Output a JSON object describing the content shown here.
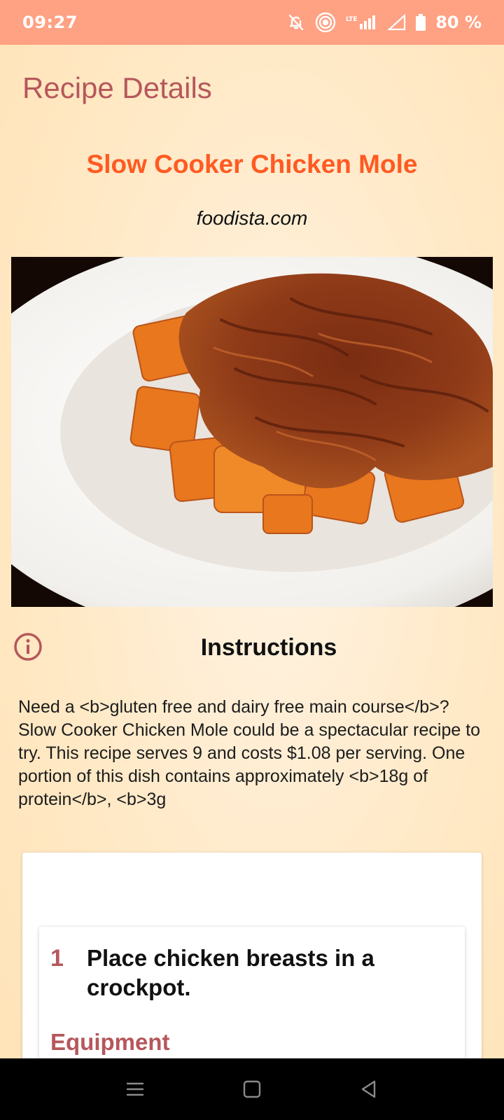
{
  "status_bar": {
    "time": "09:27",
    "battery_percent": "80 %",
    "network_label": "LTE",
    "icons": [
      "mute-icon",
      "hotspot-icon",
      "signal-icon",
      "signal-empty-icon",
      "battery-icon"
    ]
  },
  "header": {
    "title": "Recipe Details"
  },
  "recipe": {
    "title": "Slow Cooker Chicken Mole",
    "source": "foodista.com",
    "image_alt": "Slow Cooker Chicken Mole"
  },
  "instructions": {
    "heading": "Instructions",
    "summary": "Need a <b>gluten free and dairy free main course</b>? Slow Cooker Chicken Mole could be a spectacular recipe to try. This recipe serves 9 and costs $1.08 per serving. One portion of this dish contains approximately <b>18g of protein</b>, <b>3g",
    "steps": [
      {
        "number": "1",
        "text": "Place chicken breasts in a crockpot.",
        "equipment_heading": "Equipment"
      }
    ]
  },
  "colors": {
    "status_bar": "#ffa183",
    "accent": "#b6575b",
    "recipe_title": "#ff5a22"
  },
  "nav_bar": {
    "icons": [
      "menu-icon",
      "home-icon",
      "back-icon"
    ]
  }
}
